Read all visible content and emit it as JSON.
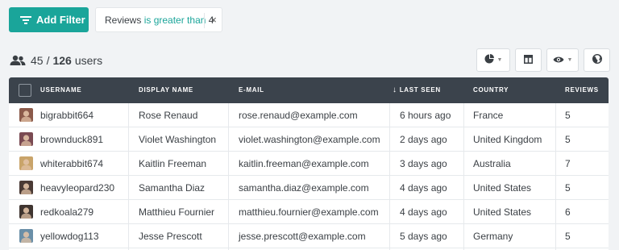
{
  "filter_bar": {
    "add_filter_label": "Add Filter",
    "active_filter": {
      "field": "Reviews",
      "operator": "is greater than",
      "value": "4"
    },
    "remove_glyph": "×"
  },
  "summary": {
    "shown": "45",
    "separator": "/",
    "total": "126",
    "unit": "users"
  },
  "toolbar": {
    "buttons": [
      "chart-icon",
      "column-layout-icon",
      "eye-icon",
      "globe-icon"
    ]
  },
  "table": {
    "columns": [
      "USERNAME",
      "DISPLAY NAME",
      "E-MAIL",
      "LAST SEEN",
      "COUNTRY",
      "REVIEWS"
    ],
    "sort_indicator": "↓",
    "rows": [
      {
        "username": "bigrabbit664",
        "display_name": "Rose Renaud",
        "email": "rose.renaud@example.com",
        "last_seen": "6 hours ago",
        "country": "France",
        "reviews": "5",
        "avatar_color": "#8b5a4a"
      },
      {
        "username": "brownduck891",
        "display_name": "Violet Washington",
        "email": "violet.washington@example.com",
        "last_seen": "2 days ago",
        "country": "United Kingdom",
        "reviews": "5",
        "avatar_color": "#7a4a52"
      },
      {
        "username": "whiterabbit674",
        "display_name": "Kaitlin Freeman",
        "email": "kaitlin.freeman@example.com",
        "last_seen": "3 days ago",
        "country": "Australia",
        "reviews": "7",
        "avatar_color": "#c9a46a"
      },
      {
        "username": "heavyleopard230",
        "display_name": "Samantha Diaz",
        "email": "samantha.diaz@example.com",
        "last_seen": "4 days ago",
        "country": "United States",
        "reviews": "5",
        "avatar_color": "#4a3a35"
      },
      {
        "username": "redkoala279",
        "display_name": "Matthieu Fournier",
        "email": "matthieu.fournier@example.com",
        "last_seen": "4 days ago",
        "country": "United States",
        "reviews": "6",
        "avatar_color": "#3f3530"
      },
      {
        "username": "yellowdog113",
        "display_name": "Jesse Prescott",
        "email": "jesse.prescott@example.com",
        "last_seen": "5 days ago",
        "country": "Germany",
        "reviews": "5",
        "avatar_color": "#6a8fa8"
      }
    ]
  },
  "colors": {
    "accent": "#1aa59a",
    "header_bg": "#3b434c",
    "page_bg": "#f1f3f5"
  }
}
